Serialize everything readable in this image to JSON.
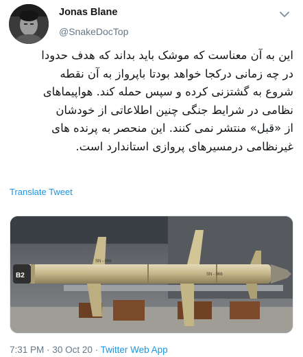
{
  "tweet": {
    "author_name": "Jonas Blane",
    "author_handle": "@SnakeDocTop",
    "body_lines": [
      "این به آن معناست که موشک باید بداند که هدف حدودا",
      "در چه زمانی درکجا خواهد بودتا باپرواز به آن نقطه",
      "شروع به گشتزنی کرده و سپس حمله کند. هواپیماهای",
      "نظامی در شرایط جنگی چنین اطلاعاتی از خودشان",
      "از «قبل» منتشر نمی کنند. این منحصر به پرنده های",
      "غیرنظامی درمسیرهای پروازی استاندارد است."
    ],
    "translate_label": "Translate Tweet",
    "time": "7:31 PM",
    "date": "30 Oct 20",
    "separator": "·",
    "source_app": "Twitter Web App"
  },
  "media": {
    "missile_markings": [
      "B2",
      "SN - 066",
      "SN - 066"
    ]
  },
  "icons": {
    "more": "chevron-down-icon",
    "avatar": "user-avatar"
  },
  "colors": {
    "link": "#1b95e0",
    "secondary_text": "#657786",
    "primary_text": "#14171a"
  }
}
